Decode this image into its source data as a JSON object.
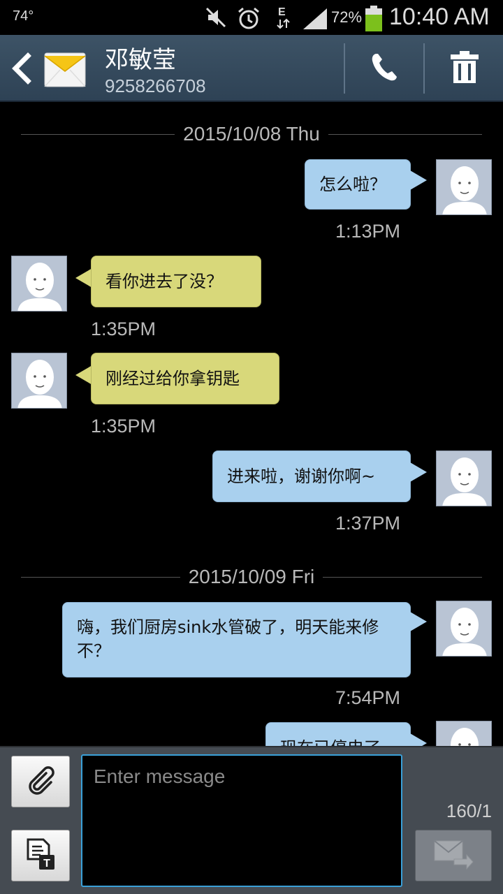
{
  "status_bar": {
    "temperature": "74°",
    "battery_percent": "72%",
    "time": "10:40 AM",
    "icons": [
      "mute-icon",
      "alarm-icon",
      "data-e-icon",
      "signal-icon",
      "battery-icon"
    ]
  },
  "header": {
    "contact_name": "邓敏莹",
    "contact_number": "9258266708",
    "icons": [
      "back-arrow-icon",
      "envelope-icon",
      "phone-icon",
      "trash-icon"
    ]
  },
  "conversation": {
    "date_separators": [
      "2015/10/08 Thu",
      "2015/10/09 Fri"
    ],
    "messages": [
      {
        "direction": "outgoing",
        "text": "怎么啦？",
        "time": "1:13PM"
      },
      {
        "direction": "incoming",
        "text": "看你进去了没？",
        "time": "1:35PM"
      },
      {
        "direction": "incoming",
        "text": "刚经过给你拿钥匙",
        "time": "1:35PM"
      },
      {
        "direction": "outgoing",
        "text": "进来啦，谢谢你啊~",
        "time": "1:37PM"
      },
      {
        "direction": "outgoing",
        "text": "嗨，我们厨房sink水管破了，明天能来修不？",
        "time": "7:54PM"
      },
      {
        "direction": "outgoing",
        "text": "现在已停电了",
        "time": ""
      }
    ]
  },
  "compose": {
    "placeholder": "Enter message",
    "value": "",
    "char_count": "160/1",
    "icons": [
      "paperclip-icon",
      "template-icon",
      "send-icon"
    ]
  },
  "colors": {
    "header_bg": "#34495c",
    "outgoing_bubble": "#a9d0ee",
    "incoming_bubble": "#d8d87a",
    "input_border": "#3aa0d8",
    "compose_bg": "#454b52"
  }
}
